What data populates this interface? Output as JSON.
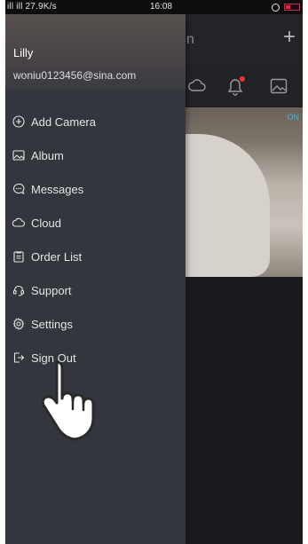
{
  "status_bar": {
    "signal": "ill ill 27.9K/s",
    "time": "16:08"
  },
  "main": {
    "title_fragment": "n",
    "add_symbol": "+",
    "preview_badge": "ON"
  },
  "drawer": {
    "username": "Lilly",
    "email": "woniu0123456@sina.com",
    "menu": [
      {
        "label": "Add Camera",
        "icon": "add-circle-icon"
      },
      {
        "label": "Album",
        "icon": "image-icon"
      },
      {
        "label": "Messages",
        "icon": "chat-bubble-icon"
      },
      {
        "label": "Cloud",
        "icon": "cloud-icon"
      },
      {
        "label": "Order List",
        "icon": "clipboard-icon"
      },
      {
        "label": "Support",
        "icon": "headset-icon"
      },
      {
        "label": "Settings",
        "icon": "gear-icon"
      },
      {
        "label": "Sign Out",
        "icon": "sign-out-icon"
      }
    ]
  },
  "colors": {
    "drawer_bg": "#33363c",
    "main_bg": "#1a1b1e",
    "accent_red": "#e33",
    "on_badge": "#3ab6e8"
  }
}
